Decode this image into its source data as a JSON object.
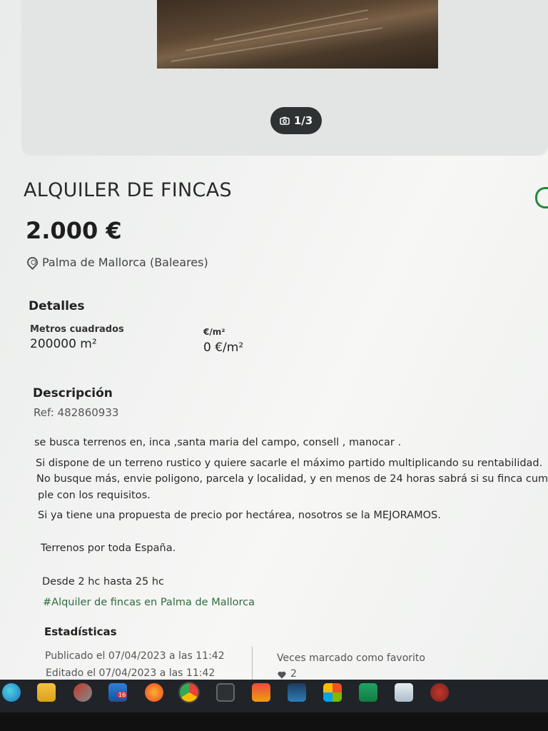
{
  "gallery": {
    "counter": "1/3"
  },
  "listing": {
    "title": "ALQUILER DE FINCAS",
    "price": "2.000 €",
    "location": "Palma de Mallorca (Baleares)"
  },
  "details": {
    "heading": "Detalles",
    "area_label": "Metros cuadrados",
    "area_value": "200000 m²",
    "price_m2_label": "€/m²",
    "price_m2_value": "0 €/m²"
  },
  "description": {
    "heading": "Descripción",
    "ref": "Ref: 482860933",
    "lines": [
      "se busca terrenos en, inca ,santa maria del campo, consell , manocar .",
      "Si dispone de un terreno rustico y quiere sacarle el máximo partido multiplicando su rentabilidad.",
      "No busque más, envie poligono, parcela y localidad, y en menos de 24 horas sabrá si su finca cum-",
      "ple con los requisitos.",
      "Si ya tiene una propuesta de precio por  hectárea, nosotros se la MEJORAMOS.",
      "Terrenos por toda España.",
      "Desde 2 hc hasta 25 hc"
    ],
    "hashtag": "#Alquiler de fincas en Palma de Mallorca"
  },
  "stats": {
    "heading": "Estadísticas",
    "published": "Publicado el 07/04/2023 a las 11:42",
    "edited": "Editado el 07/04/2023 a las 11:42",
    "favorites_label": "Veces marcado como favorito",
    "favorites_count": "2"
  },
  "taskbar": {
    "mail_badge": "16",
    "icons": [
      "edge-icon",
      "file-explorer-icon",
      "snipping-tool-icon",
      "mail-icon",
      "firefox-icon",
      "chrome-icon",
      "davinci-icon",
      "photo-app-icon",
      "media-icon",
      "store-icon",
      "excel-icon",
      "notepad-icon",
      "game-icon"
    ]
  },
  "colors": {
    "accent_green": "#1f8a3a",
    "hashtag_green": "#2f6b3e",
    "counter_bg": "#2e3233",
    "taskbar": "#202428"
  }
}
